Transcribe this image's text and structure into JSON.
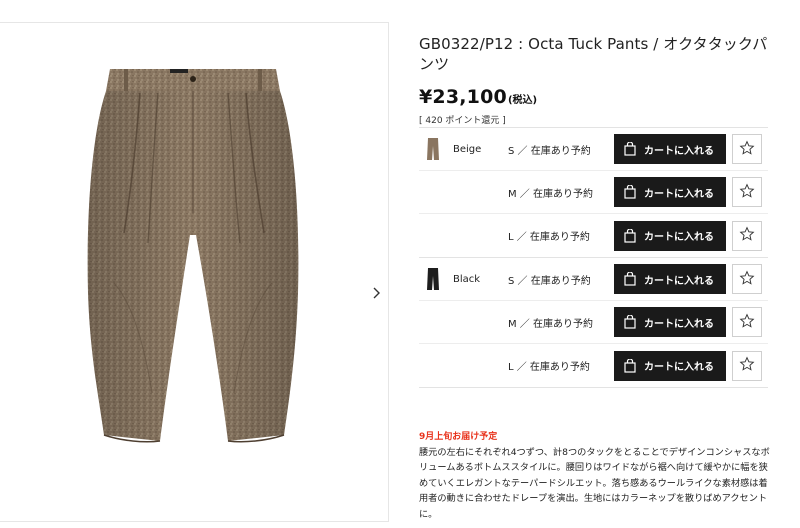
{
  "product": {
    "title": "GB0322/P12 : Octa Tuck Pants / オクタタックパンツ",
    "price": "¥23,100",
    "tax_label": "(税込)",
    "points": "[ 420 ポイント還元 ]",
    "delivery_note": "9月上旬お届け予定",
    "description": "腰元の左右にそれぞれ4つずつ、計8つのタックをとることでデザインコンシャスなボリュームあるボトムススタイルに。腰回りはワイドながら裾へ向けて緩やかに幅を狭めていくエレガントなテーパードシルエット。落ち感あるウールライクな素材感は着用者の動きに合わせたドレープを演出。生地にはカラーネップを散りばめアクセントに。"
  },
  "variants": [
    {
      "color": "Beige",
      "swatch_color": "#8a7560",
      "sizes": [
        {
          "size_stock": "S ／ 在庫あり予約",
          "cart_label": "カートに入れる"
        },
        {
          "size_stock": "M ／ 在庫あり予約",
          "cart_label": "カートに入れる"
        },
        {
          "size_stock": "L ／ 在庫あり予約",
          "cart_label": "カートに入れる"
        }
      ]
    },
    {
      "color": "Black",
      "swatch_color": "#1e1e1e",
      "sizes": [
        {
          "size_stock": "S ／ 在庫あり予約",
          "cart_label": "カートに入れる"
        },
        {
          "size_stock": "M ／ 在庫あり予約",
          "cart_label": "カートに入れる"
        },
        {
          "size_stock": "L ／ 在庫あり予約",
          "cart_label": "カートに入れる"
        }
      ]
    }
  ],
  "colors": {
    "button_bg": "#1a1a1a",
    "delivery_red": "#e8331c",
    "pants_beige": "#8c7a63"
  },
  "icons": {
    "gallery_next": "chevron-right-icon",
    "cart": "shopping-bag-icon",
    "favorite": "star-outline-icon"
  }
}
